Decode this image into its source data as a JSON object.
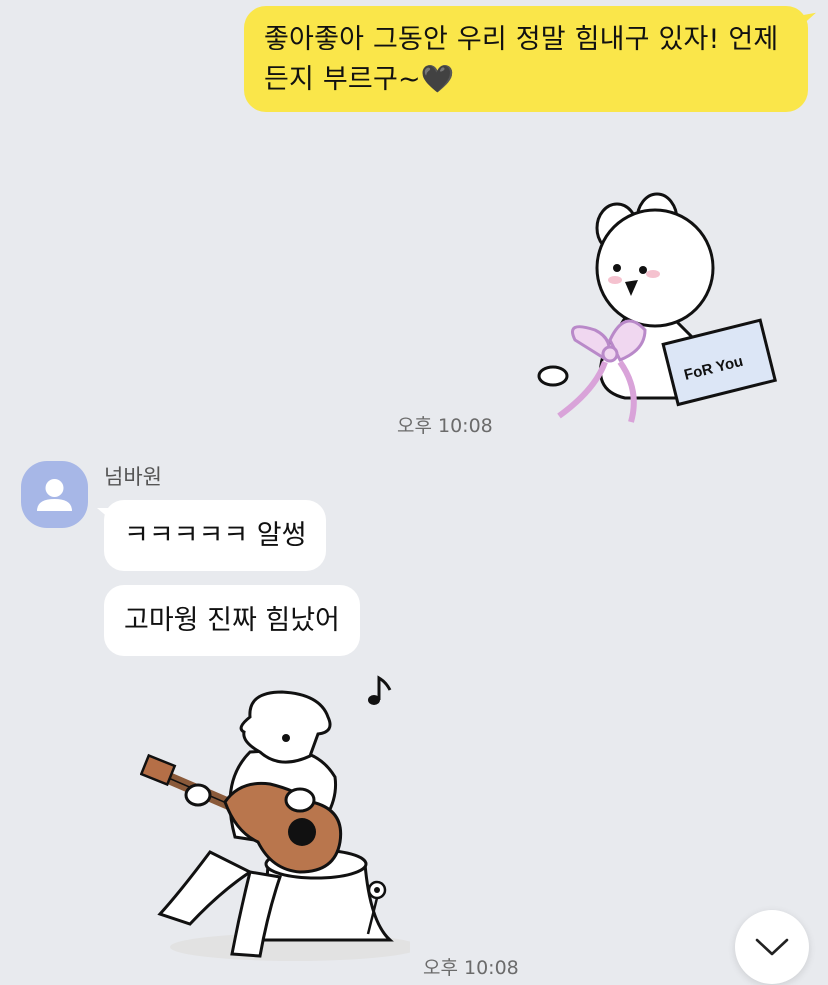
{
  "messages": {
    "outgoing_text": "좋아좋아 그동안 우리 정말 힘내구 있자! 언제든지 부르구~🖤",
    "outgoing_time": "오후 10:08",
    "sender_name": "넘바원",
    "incoming_1": "ㅋㅋㅋㅋㅋ 알썽",
    "incoming_2": "고마웡 진짜 힘났어",
    "incoming_time": "오후 10:08"
  },
  "stickers": {
    "bunny_card_text": "FoR You"
  },
  "colors": {
    "background": "#e8eaee",
    "outgoing_bubble": "#fae64a",
    "incoming_bubble": "#ffffff",
    "avatar": "#a7b7e7"
  },
  "icons": {
    "avatar": "person-icon",
    "scroll_down": "chevron-down-icon"
  }
}
